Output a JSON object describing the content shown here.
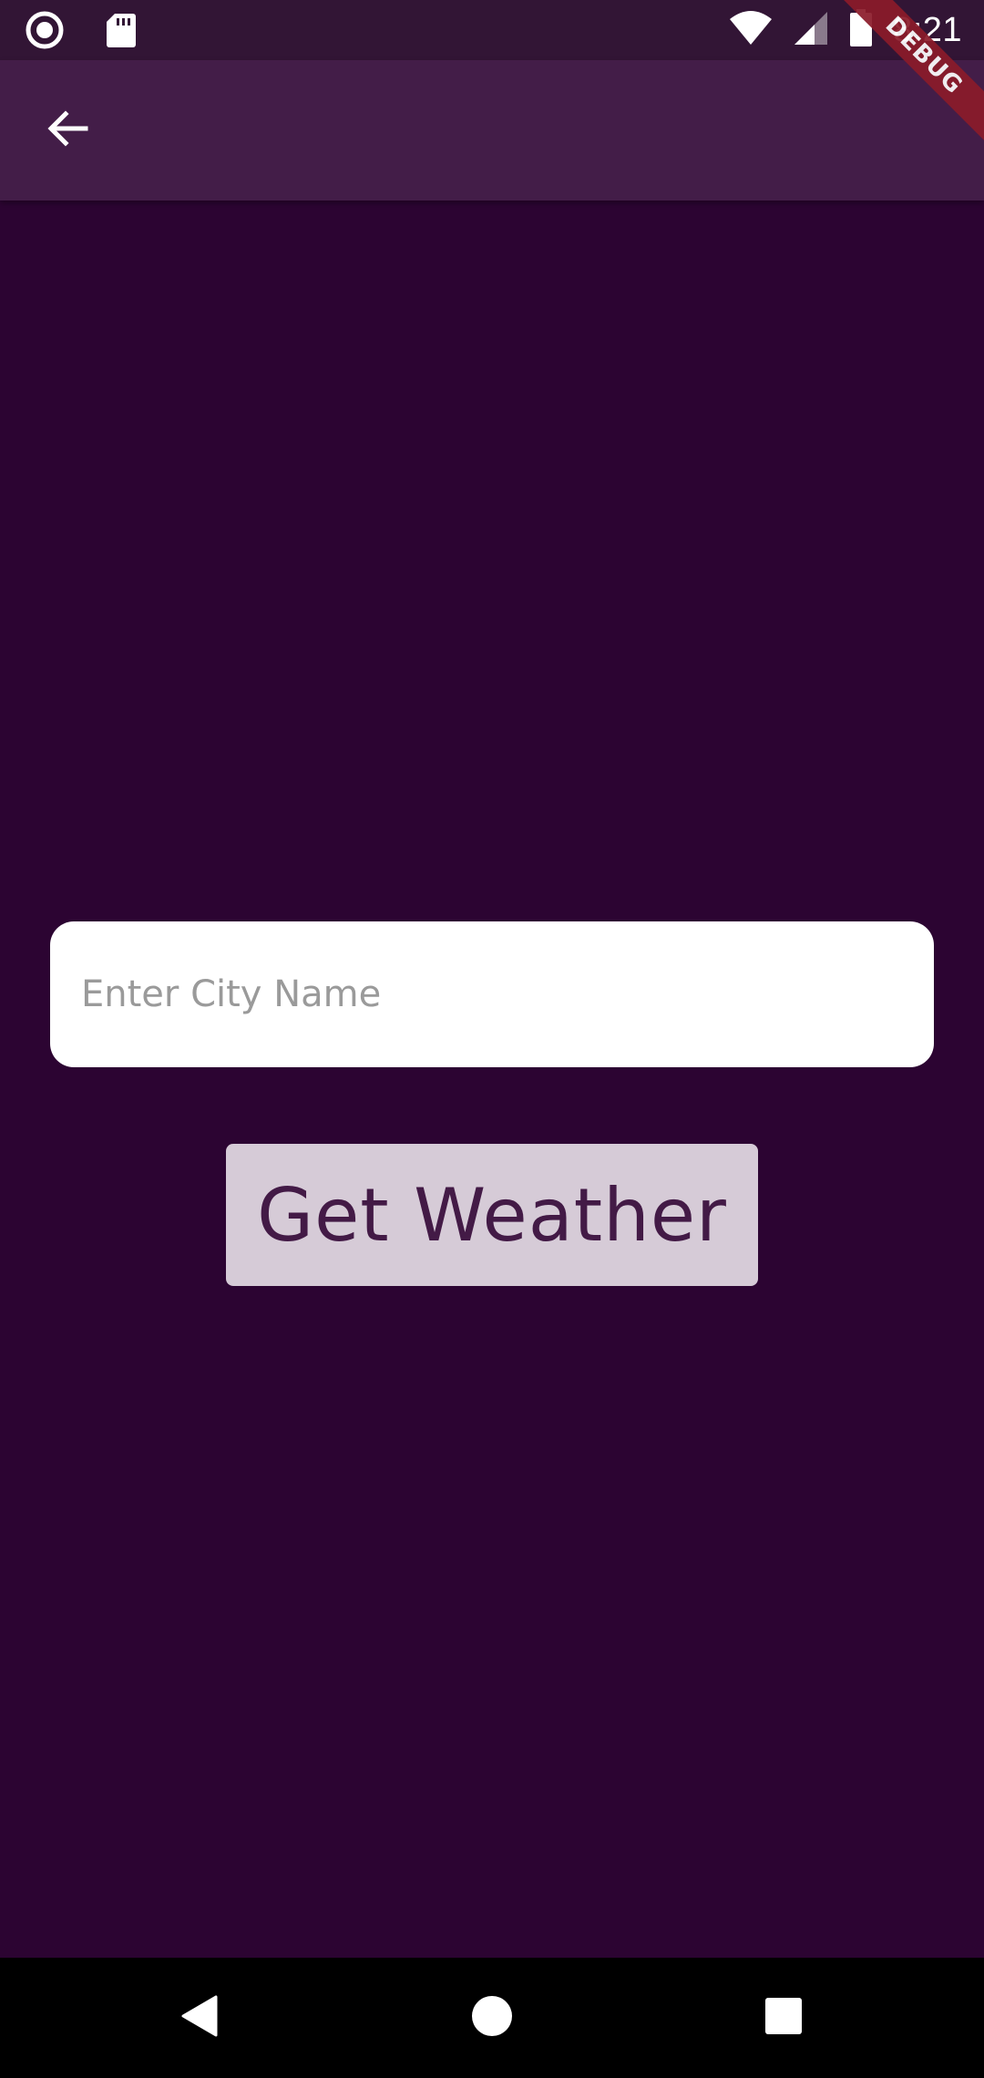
{
  "status_bar": {
    "time": "8:21",
    "icons": [
      "record-icon",
      "sd-card-icon",
      "wifi-icon",
      "signal-icon",
      "battery-icon"
    ]
  },
  "debug_banner": {
    "label": "DEBUG"
  },
  "app_bar": {
    "back_icon": "arrow-back-icon"
  },
  "city_input": {
    "placeholder": "Enter City Name",
    "value": ""
  },
  "get_weather_button": {
    "label": "Get Weather"
  },
  "nav_bar": {
    "icons": [
      "back-triangle-icon",
      "home-circle-icon",
      "recents-square-icon"
    ]
  },
  "colors": {
    "background": "#2c0432",
    "app_bar": "#431d48",
    "status_bar": "#321535",
    "button_bg": "#d6cbd7",
    "button_text": "#431a46",
    "debug_ribbon": "#8b1b2a"
  }
}
